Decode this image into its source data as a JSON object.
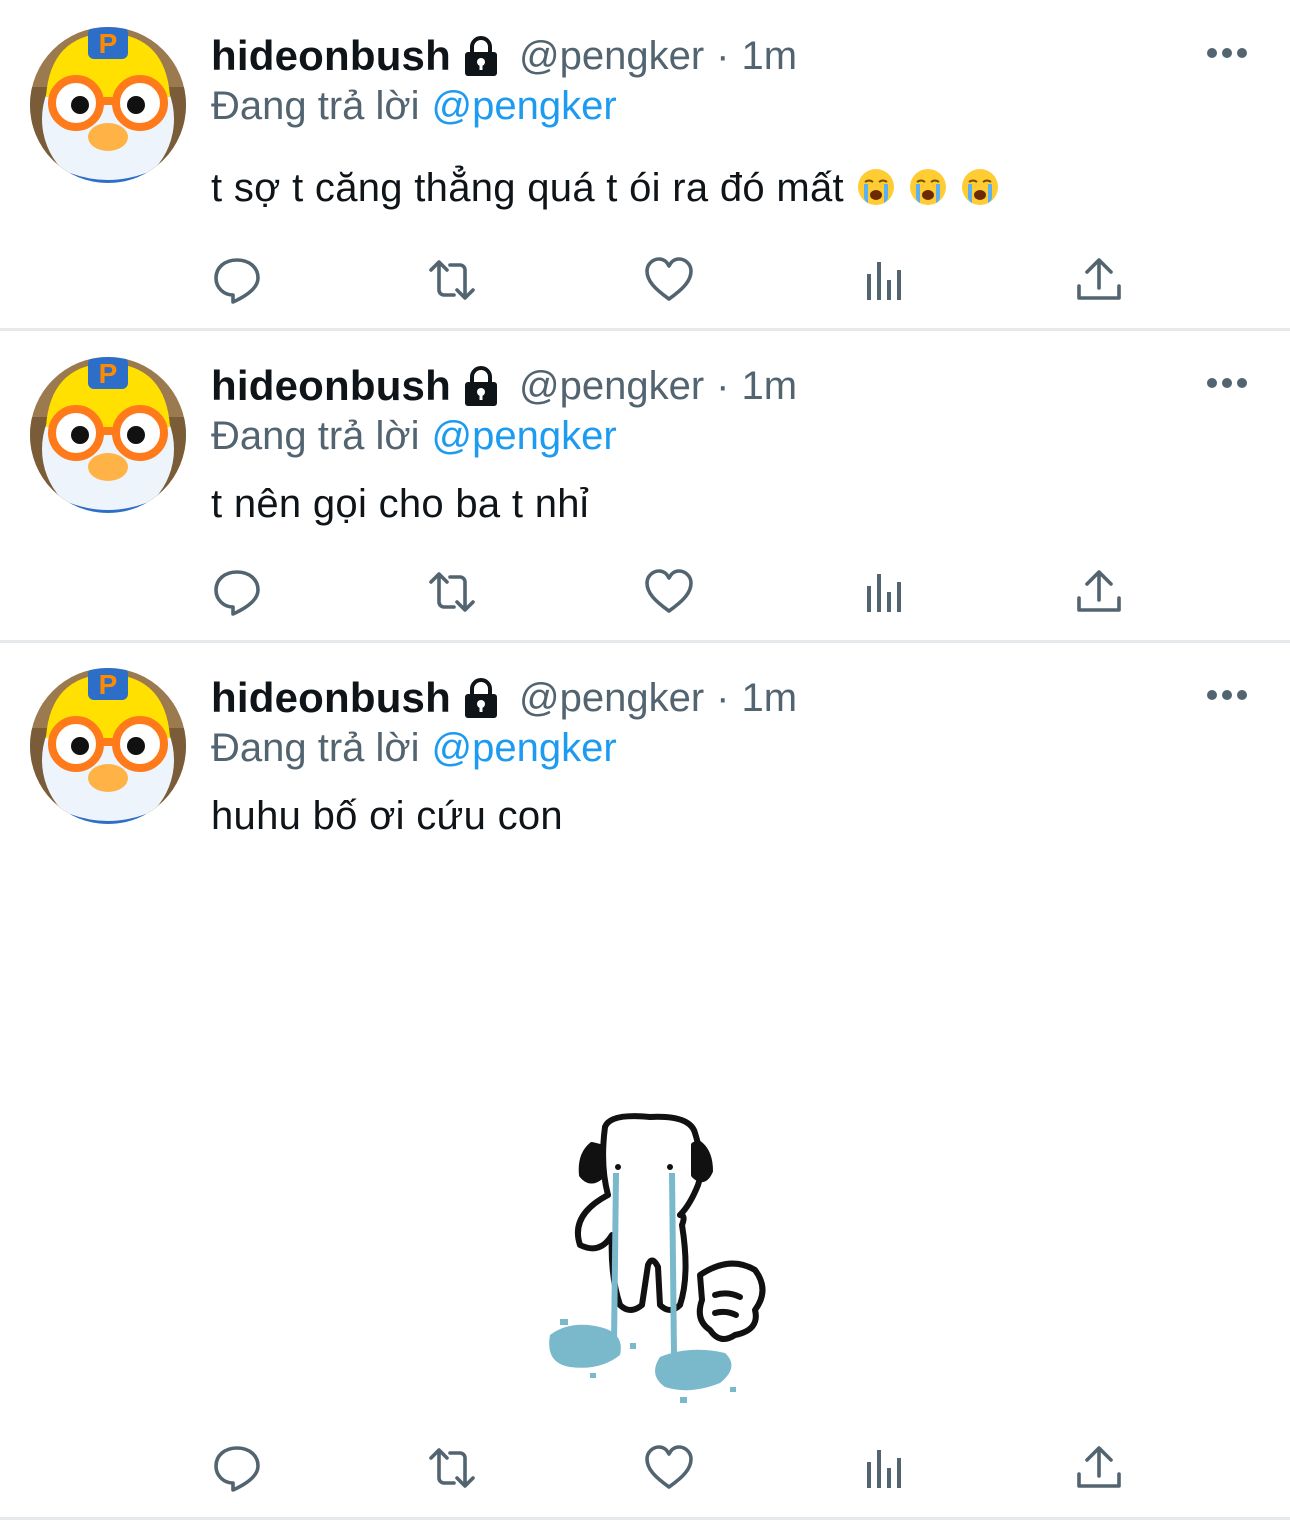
{
  "tweets": [
    {
      "name": "hideonbush",
      "handle": "@pengker",
      "separator": "·",
      "time": "1m",
      "reply_prefix": "Đang trả lời",
      "reply_to": "@pengker",
      "text": "t sợ t căng thẳng quá t ói ra đó mất",
      "emojis": [
        "loudly-crying-face",
        "loudly-crying-face",
        "loudly-crying-face"
      ],
      "has_media": false
    },
    {
      "name": "hideonbush",
      "handle": "@pengker",
      "separator": "·",
      "time": "1m",
      "reply_prefix": "Đang trả lời",
      "reply_to": "@pengker",
      "text": "t nên gọi cho ba t nhỉ",
      "emojis": [],
      "has_media": false
    },
    {
      "name": "hideonbush",
      "handle": "@pengker",
      "separator": "·",
      "time": "1m",
      "reply_prefix": "Đang trả lời",
      "reply_to": "@pengker",
      "text": "huhu bố ơi cứu con",
      "emojis": [],
      "has_media": true,
      "media_description": "crying cartoon cat sticker with headphones"
    }
  ],
  "icons": {
    "protected": "lock-icon",
    "more": "more-icon",
    "actions": [
      "reply-icon",
      "retweet-icon",
      "like-icon",
      "analytics-icon",
      "share-icon"
    ]
  },
  "colors": {
    "text": "#0f1419",
    "secondary": "#536471",
    "mention": "#1d9bf0",
    "divider": "#e6e9ec",
    "tears": "#7ab8cc"
  }
}
